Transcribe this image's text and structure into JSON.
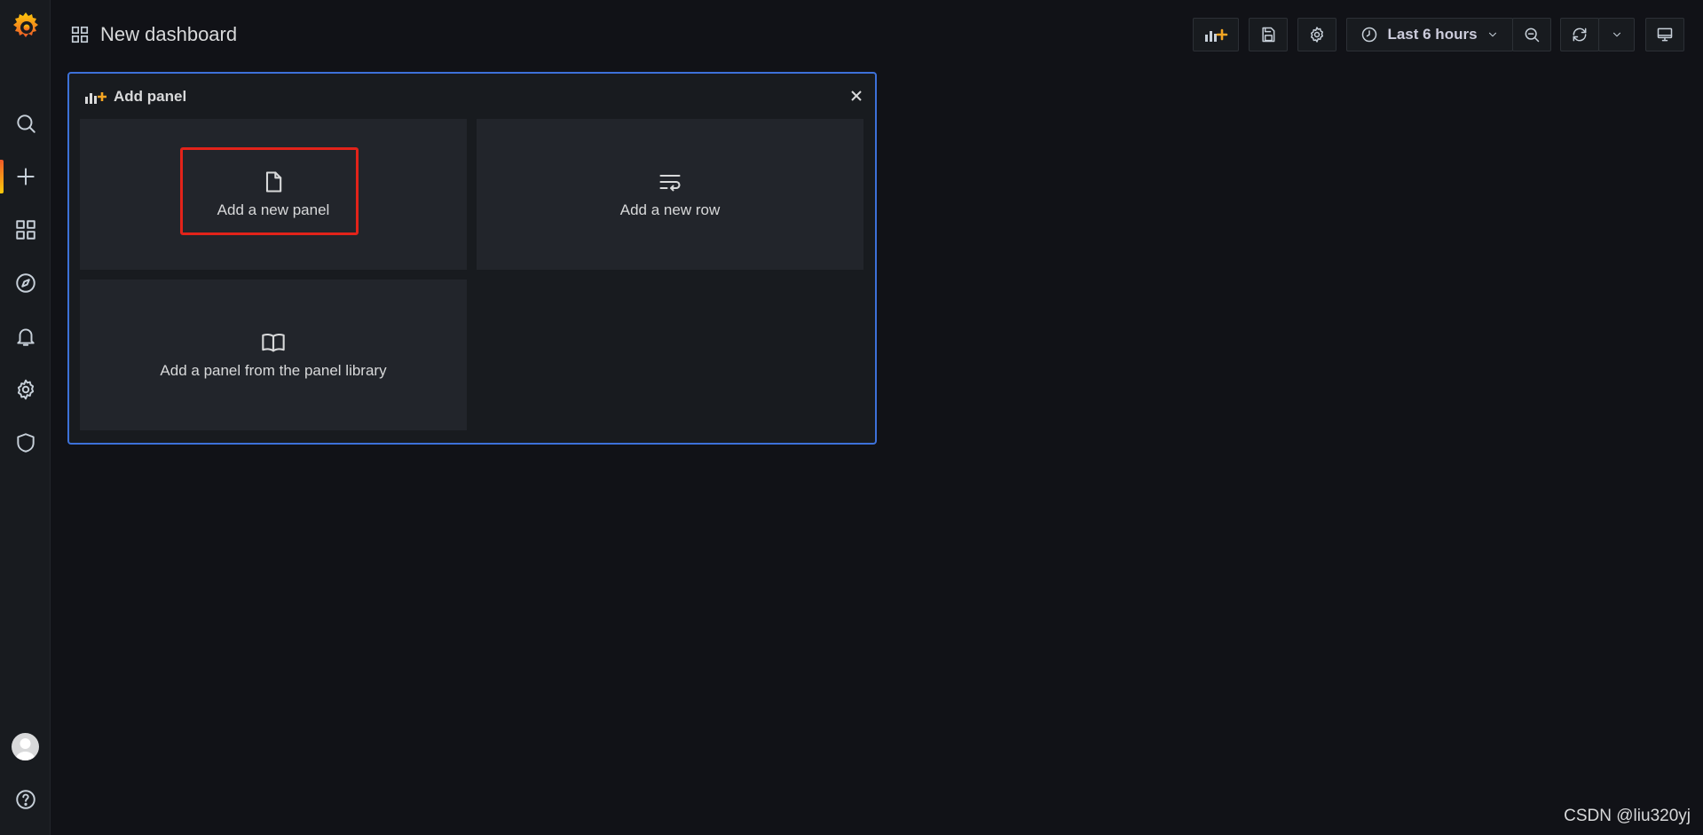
{
  "header": {
    "title": "New dashboard"
  },
  "toolbar": {
    "time_range": "Last 6 hours",
    "accent_color": "#f5a623"
  },
  "add_panel": {
    "title": "Add panel",
    "options": [
      {
        "label": "Add a new panel",
        "icon": "file-icon"
      },
      {
        "label": "Add a new row",
        "icon": "wrap-text-icon"
      },
      {
        "label": "Add a panel from the panel library",
        "icon": "book-open-icon"
      }
    ],
    "highlight_color": "#e2231a"
  },
  "sidebar": {
    "items": [
      {
        "icon": "search-icon"
      },
      {
        "icon": "plus-icon",
        "active": true
      },
      {
        "icon": "dashboards-icon"
      },
      {
        "icon": "compass-icon"
      },
      {
        "icon": "bell-icon"
      },
      {
        "icon": "gear-icon"
      },
      {
        "icon": "shield-icon"
      }
    ]
  },
  "watermark": "CSDN @liu320yj"
}
